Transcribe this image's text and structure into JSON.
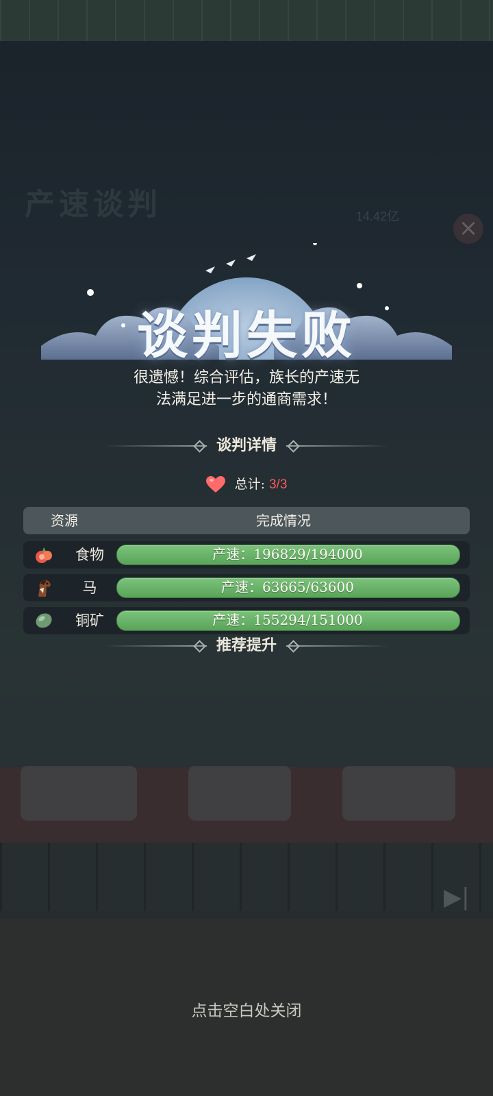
{
  "background": {
    "title": "产速谈判",
    "value": "14.42亿",
    "close_icon": "close-icon",
    "skip_icon": "skip-forward-icon"
  },
  "result": {
    "title": "谈判失败",
    "message_line1": "很遗憾！综合评估，族长的产速无",
    "message_line2": "法满足进一步的通商需求！"
  },
  "details": {
    "heading": "谈判详情",
    "total_label": "总计:",
    "total_value": "3/3",
    "heart_color": "#ff6b6b"
  },
  "table": {
    "col_resource": "资源",
    "col_status": "完成情况",
    "rows": [
      {
        "name": "食物",
        "icon": "food-icon",
        "status": "产速：196829/194000",
        "progress": 1.0
      },
      {
        "name": "马",
        "icon": "horse-icon",
        "status": "产速：63665/63600",
        "progress": 1.0
      },
      {
        "name": "铜矿",
        "icon": "copper-ore-icon",
        "status": "产速：155294/151000",
        "progress": 1.0
      }
    ]
  },
  "recommend": {
    "heading": "推荐提升"
  },
  "footer": {
    "close_hint": "点击空白处关闭"
  },
  "colors": {
    "bar_fill": "#6bb36a",
    "total_value": "#ff5a5a"
  }
}
